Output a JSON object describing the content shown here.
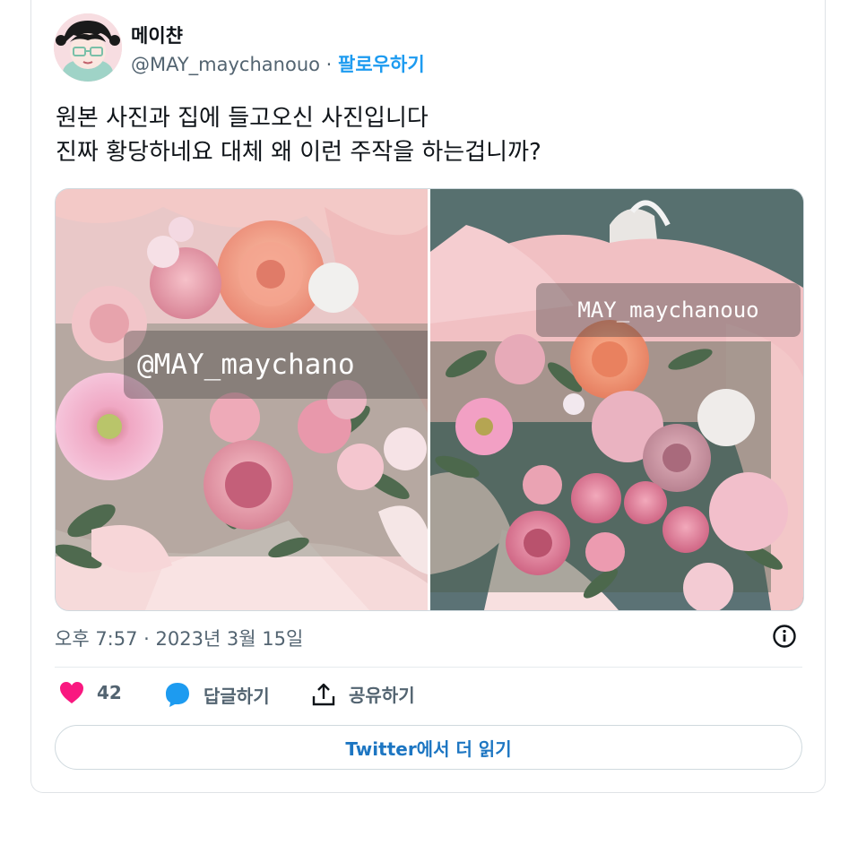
{
  "user": {
    "display_name": "메이챤",
    "handle": "@MAY_maychanouo",
    "separator": "·",
    "follow_label": "팔로우하기"
  },
  "tweet": {
    "lines": [
      "원본 사진과 집에 들고오신 사진입니다",
      "진짜 황당하네요 대체 왜 이런 주작을 하는겁니까?"
    ],
    "timestamp": "오후 7:57 · 2023년 3월 15일"
  },
  "media": {
    "left_watermark": "@MAY_maychano",
    "right_watermark": "MAY_maychanouo"
  },
  "actions": {
    "like_count": "42",
    "reply_label": "답글하기",
    "share_label": "공유하기"
  },
  "read_more_label": "Twitter에서 더 읽기",
  "icons": {
    "like": "heart-icon",
    "reply": "speech-bubble-icon",
    "share": "share-icon",
    "info": "info-icon"
  },
  "colors": {
    "like": "#f91880",
    "reply": "#1d9bf0",
    "follow": "#1d9bf0",
    "read_more": "#1d76c2"
  }
}
